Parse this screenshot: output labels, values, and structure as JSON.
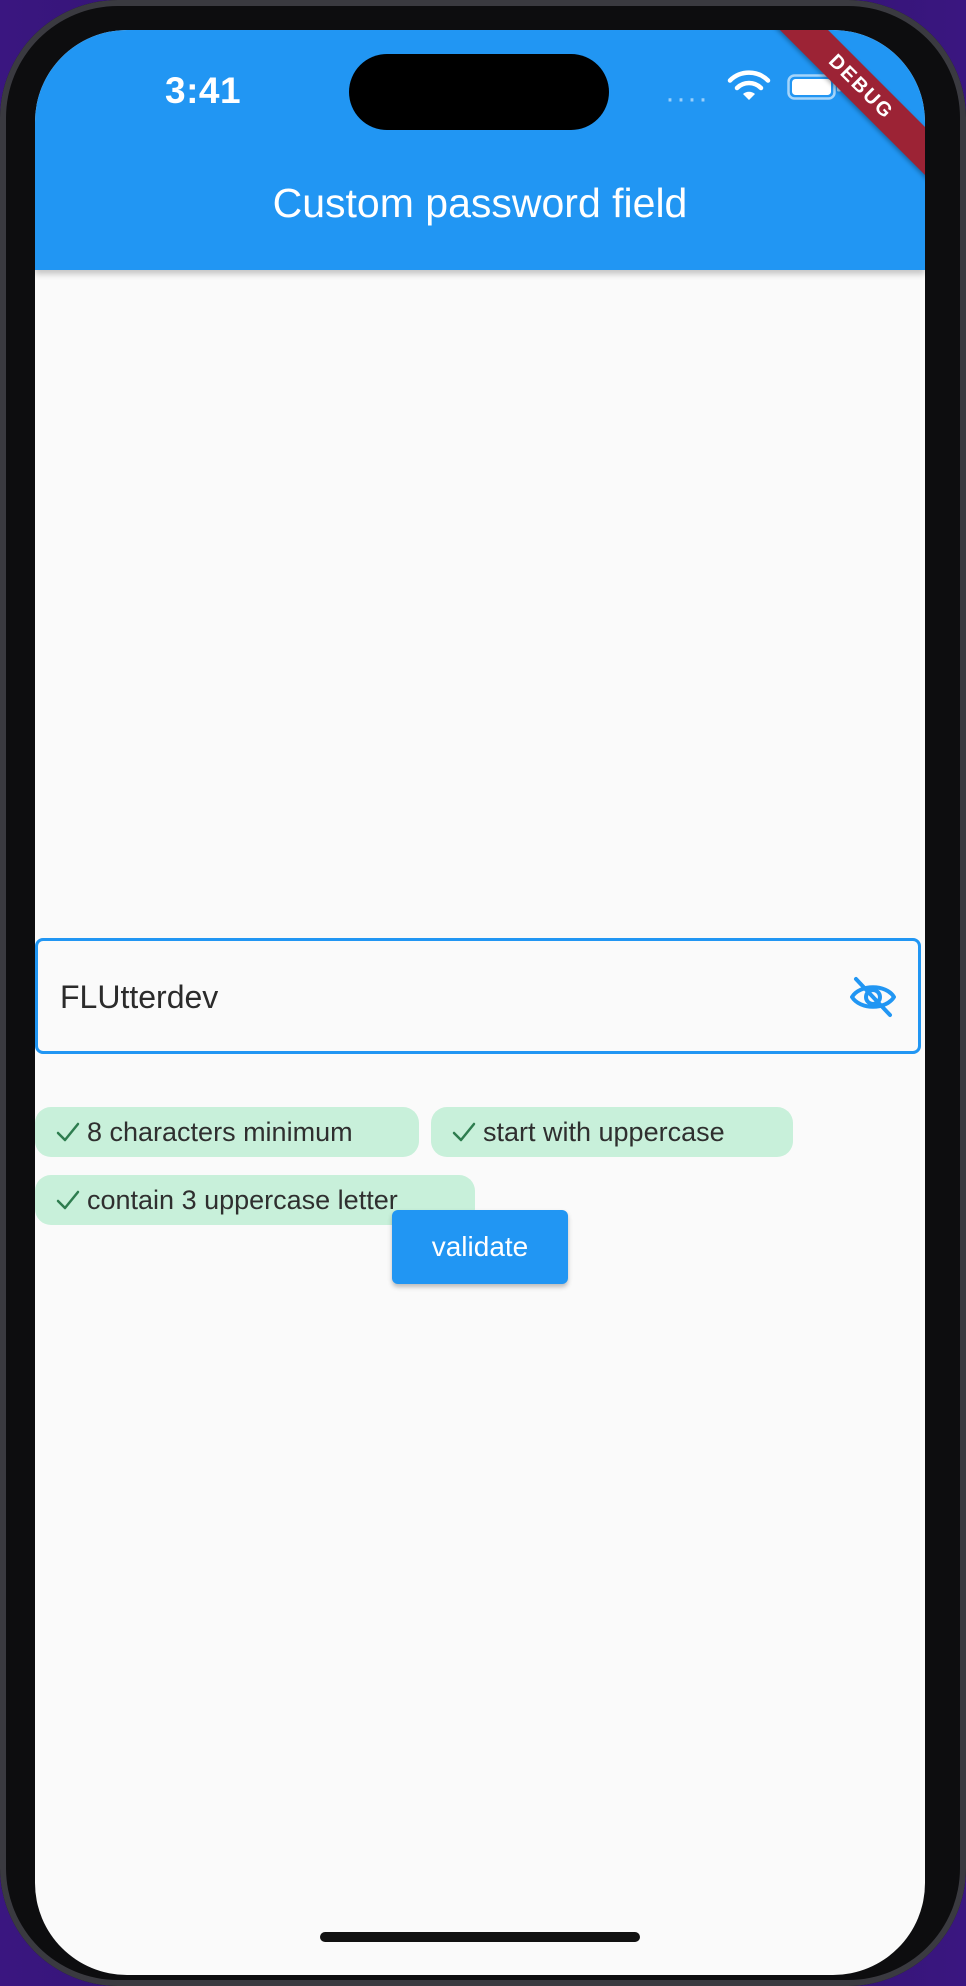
{
  "status_bar": {
    "time": "3:41",
    "signal": "····"
  },
  "debug_banner": "DEBUG",
  "app_bar": {
    "title": "Custom password field"
  },
  "password_field": {
    "value": "FLUtterdev",
    "visibility_icon": "visibility-off-icon"
  },
  "validation_chips": [
    {
      "label": "8 characters minimum",
      "passed": true
    },
    {
      "label": "start with uppercase",
      "passed": true
    },
    {
      "label": "contain 3 uppercase letter",
      "passed": true
    }
  ],
  "validate_button": {
    "label": "validate"
  },
  "colors": {
    "primary": "#2196f3",
    "chip_success_bg": "#c8f0da",
    "chip_check": "#2e7d4f",
    "debug_ribbon": "#9c2335",
    "background": "#fafafa"
  }
}
